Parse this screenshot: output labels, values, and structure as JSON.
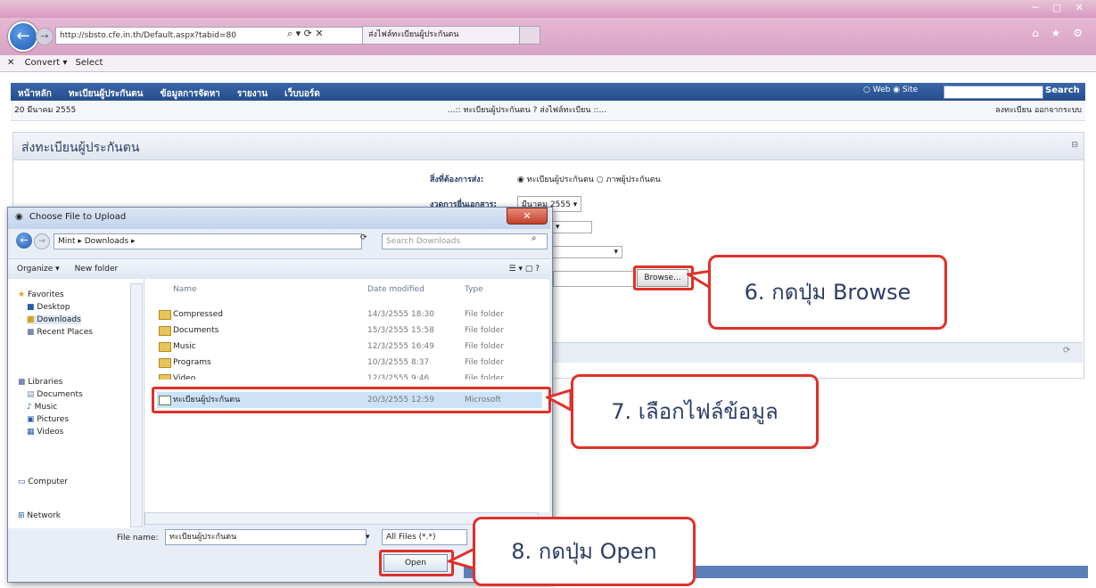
{
  "browser": {
    "address": "http://sbsto.cfe.in.th/Default.aspx?tabid=80",
    "tab_title": "ส่งไฟล์ทะเบียนผู้ประกันตน",
    "cmd_convert": "Convert",
    "cmd_select": "Select"
  },
  "site": {
    "nav": [
      "หน้าหลัก",
      "ทะเบียนผู้ประกันตน",
      "ข้อมูลการจัดหา",
      "รายงาน",
      "เว็บบอร์ด"
    ],
    "search_label": "Search",
    "radio_web": "Web",
    "radio_site": "Site",
    "date": "20 มีนาคม 2555",
    "breadcrumb": "...:: ทะเบียนผู้ประกันตน ? ส่งไฟล์ทะเบียน ::...",
    "user_links": "ลงทะเบียน ออกจากระบบ",
    "panel_title": "ส่งทะเบียนผู้ประกันตน",
    "form": {
      "label1": "สิ่งที่ต้องการส่ง:",
      "radio1": "ทะเบียนผู้ประกันตน",
      "radio2": "ภาพผู้ประกันตน",
      "label2": "งวดการยื่นเอกสาร:",
      "value2": "มีนาคม 2555",
      "browse": "Browse..."
    }
  },
  "dialog": {
    "title": "Choose File to Upload",
    "path": "Mint ▸ Downloads ▸",
    "search_placeholder": "Search Downloads",
    "organize": "Organize ▾",
    "new_folder": "New folder",
    "nav": {
      "favorites": "Favorites",
      "desktop": "Desktop",
      "downloads": "Downloads",
      "recent": "Recent Places",
      "libraries": "Libraries",
      "documents": "Documents",
      "music": "Music",
      "pictures": "Pictures",
      "videos": "Videos",
      "computer": "Computer",
      "network": "Network"
    },
    "columns": {
      "name": "Name",
      "date": "Date modified",
      "type": "Type"
    },
    "rows": [
      {
        "name": "Compressed",
        "date": "14/3/2555 18:30",
        "type": "File folder"
      },
      {
        "name": "Documents",
        "date": "15/3/2555 15:58",
        "type": "File folder"
      },
      {
        "name": "Music",
        "date": "12/3/2555 16:49",
        "type": "File folder"
      },
      {
        "name": "Programs",
        "date": "10/3/2555 8:37",
        "type": "File folder"
      },
      {
        "name": "Video",
        "date": "12/3/2555 9:46",
        "type": "File folder"
      },
      {
        "name": "ทะเบียนผู้ประกันตน",
        "date": "20/3/2555 12:59",
        "type": "Microsoft"
      }
    ],
    "file_name_label": "File name:",
    "file_name_value": "ทะเบียนผู้ประกันตน",
    "file_type": "All Files (*.*)",
    "open": "Open"
  },
  "callouts": {
    "step6": "6. กดปุ่ม Browse",
    "step7": "7. เลือกไฟล์ข้อมูล",
    "step8": "8. กดปุ่ม Open"
  },
  "colors": {
    "highlight": "#e0302a",
    "accent": "#2c3e66"
  }
}
